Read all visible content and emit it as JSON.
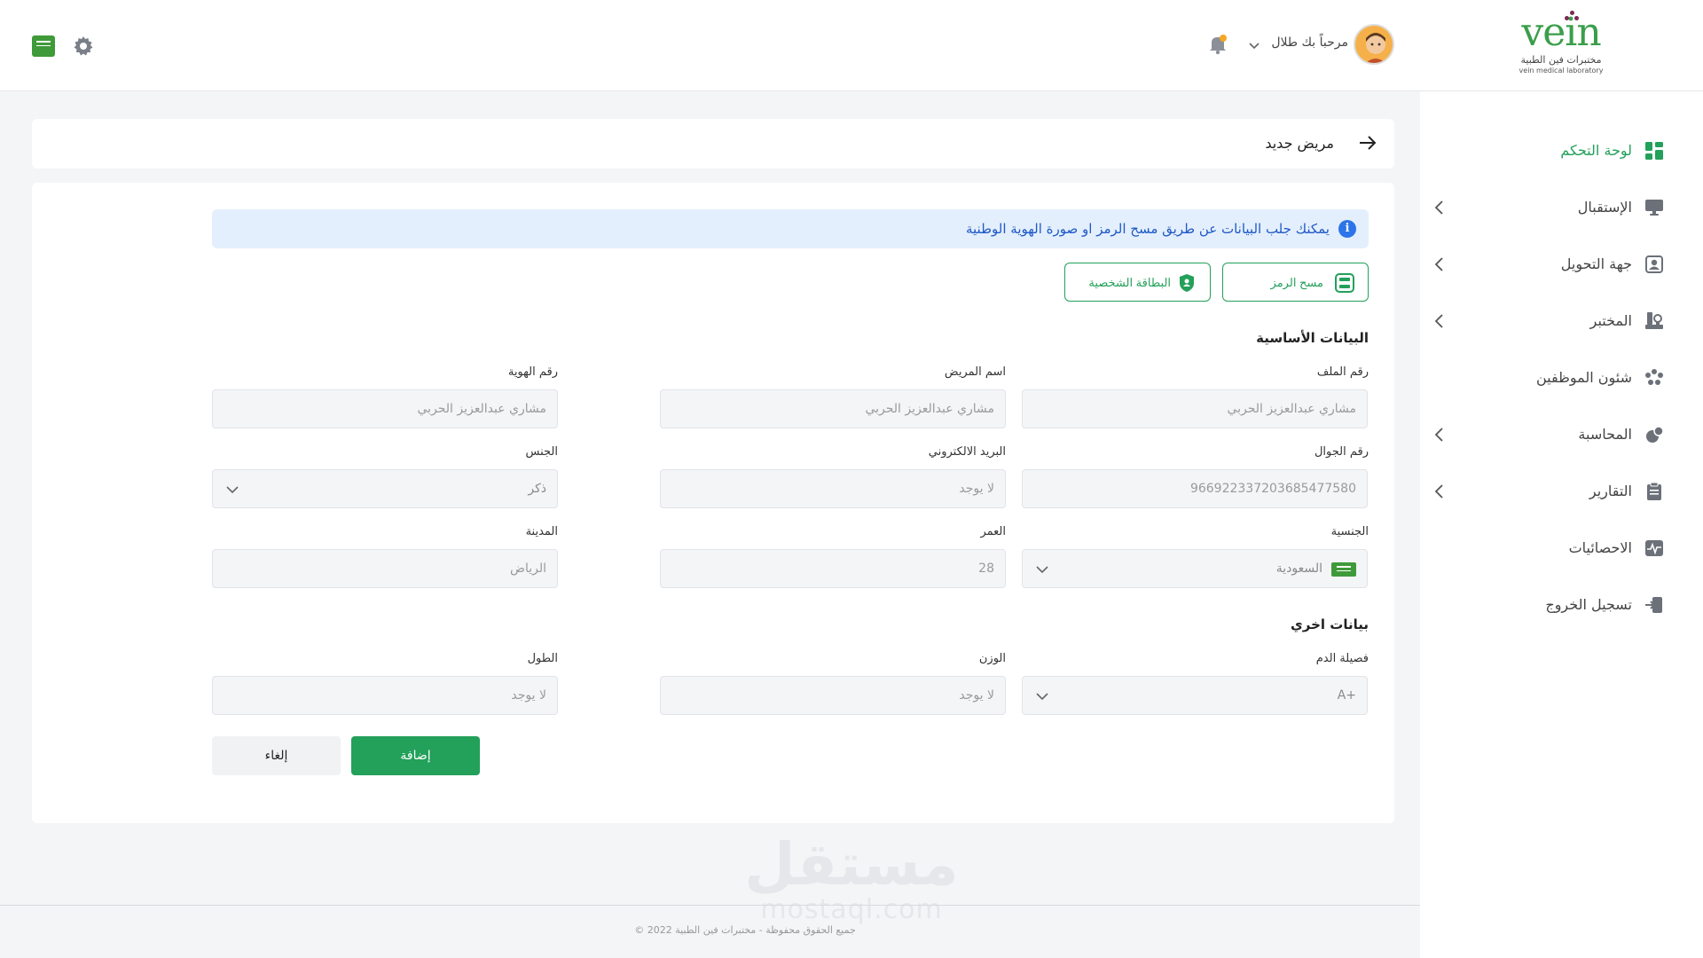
{
  "colors": {
    "accent": "#23a05a",
    "info_bg": "#e3effc",
    "info_text": "#1f58c6"
  },
  "brand": {
    "logo_text": "vein",
    "name_ar": "مختبرات فين الطبية",
    "name_en": "vein medical laboratory"
  },
  "header": {
    "greeting": "مرحباً بك طلال",
    "icons": [
      "user-avatar",
      "chevron-down-icon",
      "bell-icon",
      "gear-icon",
      "saudi-flag-icon"
    ]
  },
  "sidebar": {
    "items": [
      {
        "label": "لوحة التحكم",
        "icon": "dashboard-icon",
        "active": true,
        "has_children": false
      },
      {
        "label": "الإستقبال",
        "icon": "monitor-icon",
        "active": false,
        "has_children": true
      },
      {
        "label": "جهة التحويل",
        "icon": "contact-icon",
        "active": false,
        "has_children": true
      },
      {
        "label": "المختبر",
        "icon": "lab-icon",
        "active": false,
        "has_children": true
      },
      {
        "label": "شئون الموظفين",
        "icon": "employees-icon",
        "active": false,
        "has_children": false
      },
      {
        "label": "المحاسبة",
        "icon": "accounting-icon",
        "active": false,
        "has_children": true
      },
      {
        "label": "التقارير",
        "icon": "clipboard-icon",
        "active": false,
        "has_children": true
      },
      {
        "label": "الاحصائيات",
        "icon": "stats-icon",
        "active": false,
        "has_children": false
      },
      {
        "label": "تسجيل الخروج",
        "icon": "logout-icon",
        "active": false,
        "has_children": false
      }
    ]
  },
  "page": {
    "title": "مريض جديد"
  },
  "info": {
    "text": "يمكنك جلب البيانات عن طريق مسح الرمز او صورة الهوية الوطنية"
  },
  "actions": {
    "scan_code": "مسح الرمز",
    "id_card": "البطاقة الشخصية"
  },
  "sections": {
    "basic": "البيانات الأساسية",
    "other": "بيانات اخري"
  },
  "fields": {
    "file_no": {
      "label": "رقم الملف",
      "placeholder": "مشاري عبدالعزيز الحربي"
    },
    "patient_name": {
      "label": "اسم المريض",
      "placeholder": "مشاري عبدالعزيز الحربي"
    },
    "id_no": {
      "label": "رقم الهوية",
      "placeholder": "مشاري عبدالعزيز الحربي"
    },
    "mobile": {
      "label": "رقم الجوال",
      "placeholder": "966922337203685477580"
    },
    "email": {
      "label": "البريد الالكتروني",
      "placeholder": "لا يوجد"
    },
    "gender": {
      "label": "الجنس",
      "value": "ذكر"
    },
    "nationality": {
      "label": "الجنسية",
      "value": "السعودية"
    },
    "age": {
      "label": "العمر",
      "placeholder": "28"
    },
    "city": {
      "label": "المدينة",
      "placeholder": "الرياض"
    },
    "blood_type": {
      "label": "فصيلة الدم",
      "value": "A+"
    },
    "weight": {
      "label": "الوزن",
      "placeholder": "لا يوجد"
    },
    "height": {
      "label": "الطول",
      "placeholder": "لا يوجد"
    }
  },
  "buttons": {
    "add": "إضافة",
    "cancel": "إلغاء"
  },
  "footer": {
    "copyright": "© جميع الحقوق محفوظة - مختبرات فين الطبية 2022"
  },
  "watermark": {
    "ar": "مستقل",
    "en": "mostaql.com"
  }
}
